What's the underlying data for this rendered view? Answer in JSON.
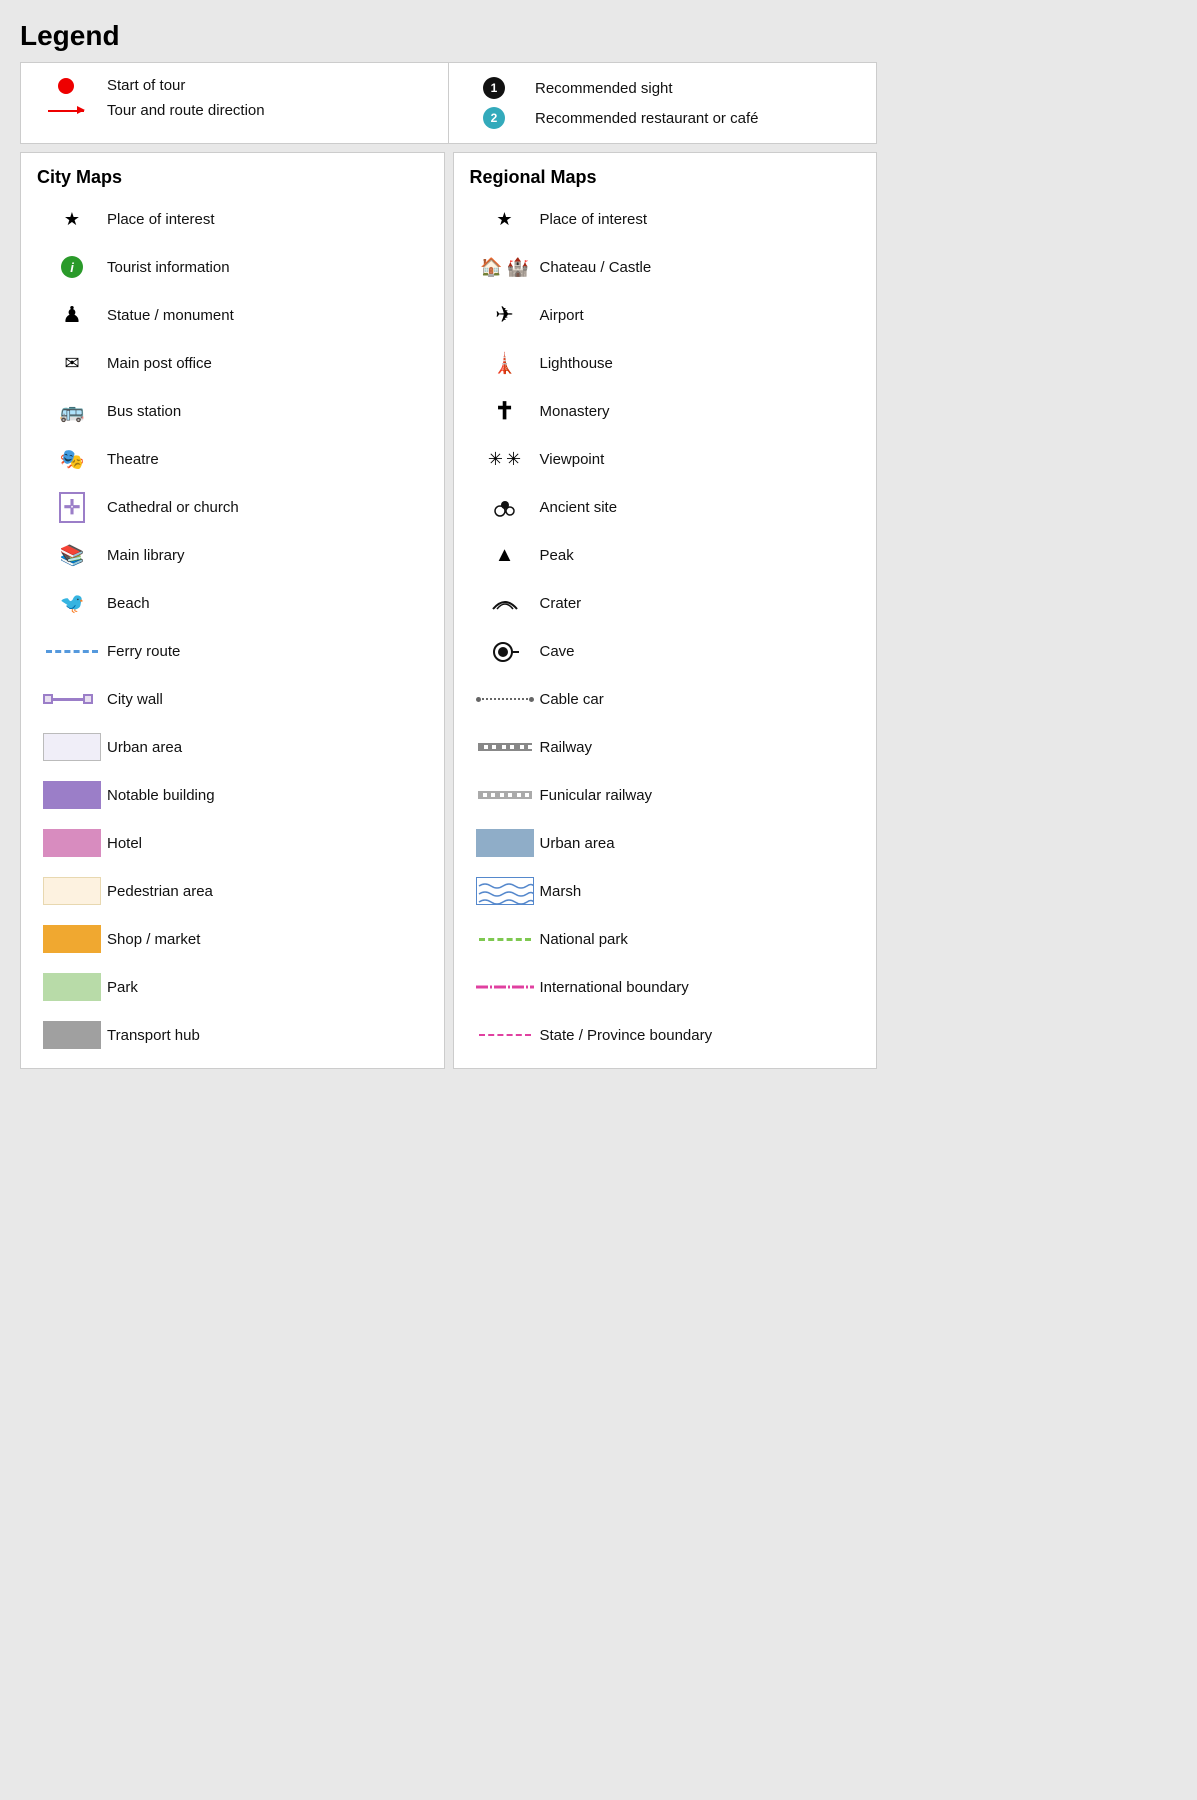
{
  "title": "Legend",
  "top": {
    "left": [
      {
        "id": "start-tour",
        "label": "Start of tour"
      },
      {
        "id": "tour-route",
        "label": "Tour and route direction"
      }
    ],
    "right": [
      {
        "id": "recommended-sight",
        "number": "1",
        "label": "Recommended sight"
      },
      {
        "id": "recommended-restaurant",
        "number": "2",
        "label": "Recommended restaurant or café"
      }
    ]
  },
  "city_maps": {
    "title": "City Maps",
    "items": [
      {
        "id": "place-interest",
        "label": "Place of interest"
      },
      {
        "id": "tourist-info",
        "label": "Tourist information"
      },
      {
        "id": "statue",
        "label": "Statue / monument"
      },
      {
        "id": "main-post",
        "label": "Main post office"
      },
      {
        "id": "bus-station",
        "label": "Bus station"
      },
      {
        "id": "theatre",
        "label": "Theatre"
      },
      {
        "id": "cathedral",
        "label": "Cathedral or church"
      },
      {
        "id": "main-library",
        "label": "Main library"
      },
      {
        "id": "beach",
        "label": "Beach"
      },
      {
        "id": "ferry-route",
        "label": "Ferry route"
      },
      {
        "id": "city-wall",
        "label": "City wall"
      },
      {
        "id": "urban-area",
        "label": "Urban area"
      },
      {
        "id": "notable-building",
        "label": "Notable building"
      },
      {
        "id": "hotel",
        "label": "Hotel"
      },
      {
        "id": "pedestrian-area",
        "label": "Pedestrian area"
      },
      {
        "id": "shop-market",
        "label": "Shop / market"
      },
      {
        "id": "park",
        "label": "Park"
      },
      {
        "id": "transport-hub",
        "label": "Transport hub"
      }
    ]
  },
  "regional_maps": {
    "title": "Regional Maps",
    "items": [
      {
        "id": "place-interest-r",
        "label": "Place of interest"
      },
      {
        "id": "chateau",
        "label": "Chateau / Castle"
      },
      {
        "id": "airport",
        "label": "Airport"
      },
      {
        "id": "lighthouse",
        "label": "Lighthouse"
      },
      {
        "id": "monastery",
        "label": "Monastery"
      },
      {
        "id": "viewpoint",
        "label": "Viewpoint"
      },
      {
        "id": "ancient-site",
        "label": "Ancient site"
      },
      {
        "id": "peak",
        "label": "Peak"
      },
      {
        "id": "crater",
        "label": "Crater"
      },
      {
        "id": "cave",
        "label": "Cave"
      },
      {
        "id": "cable-car",
        "label": "Cable car"
      },
      {
        "id": "railway",
        "label": "Railway"
      },
      {
        "id": "funicular",
        "label": "Funicular railway"
      },
      {
        "id": "urban-area-r",
        "label": "Urban area"
      },
      {
        "id": "marsh",
        "label": "Marsh"
      },
      {
        "id": "national-park",
        "label": "National park"
      },
      {
        "id": "intl-boundary",
        "label": "International boundary"
      },
      {
        "id": "state-boundary",
        "label": "State / Province boundary"
      }
    ]
  }
}
